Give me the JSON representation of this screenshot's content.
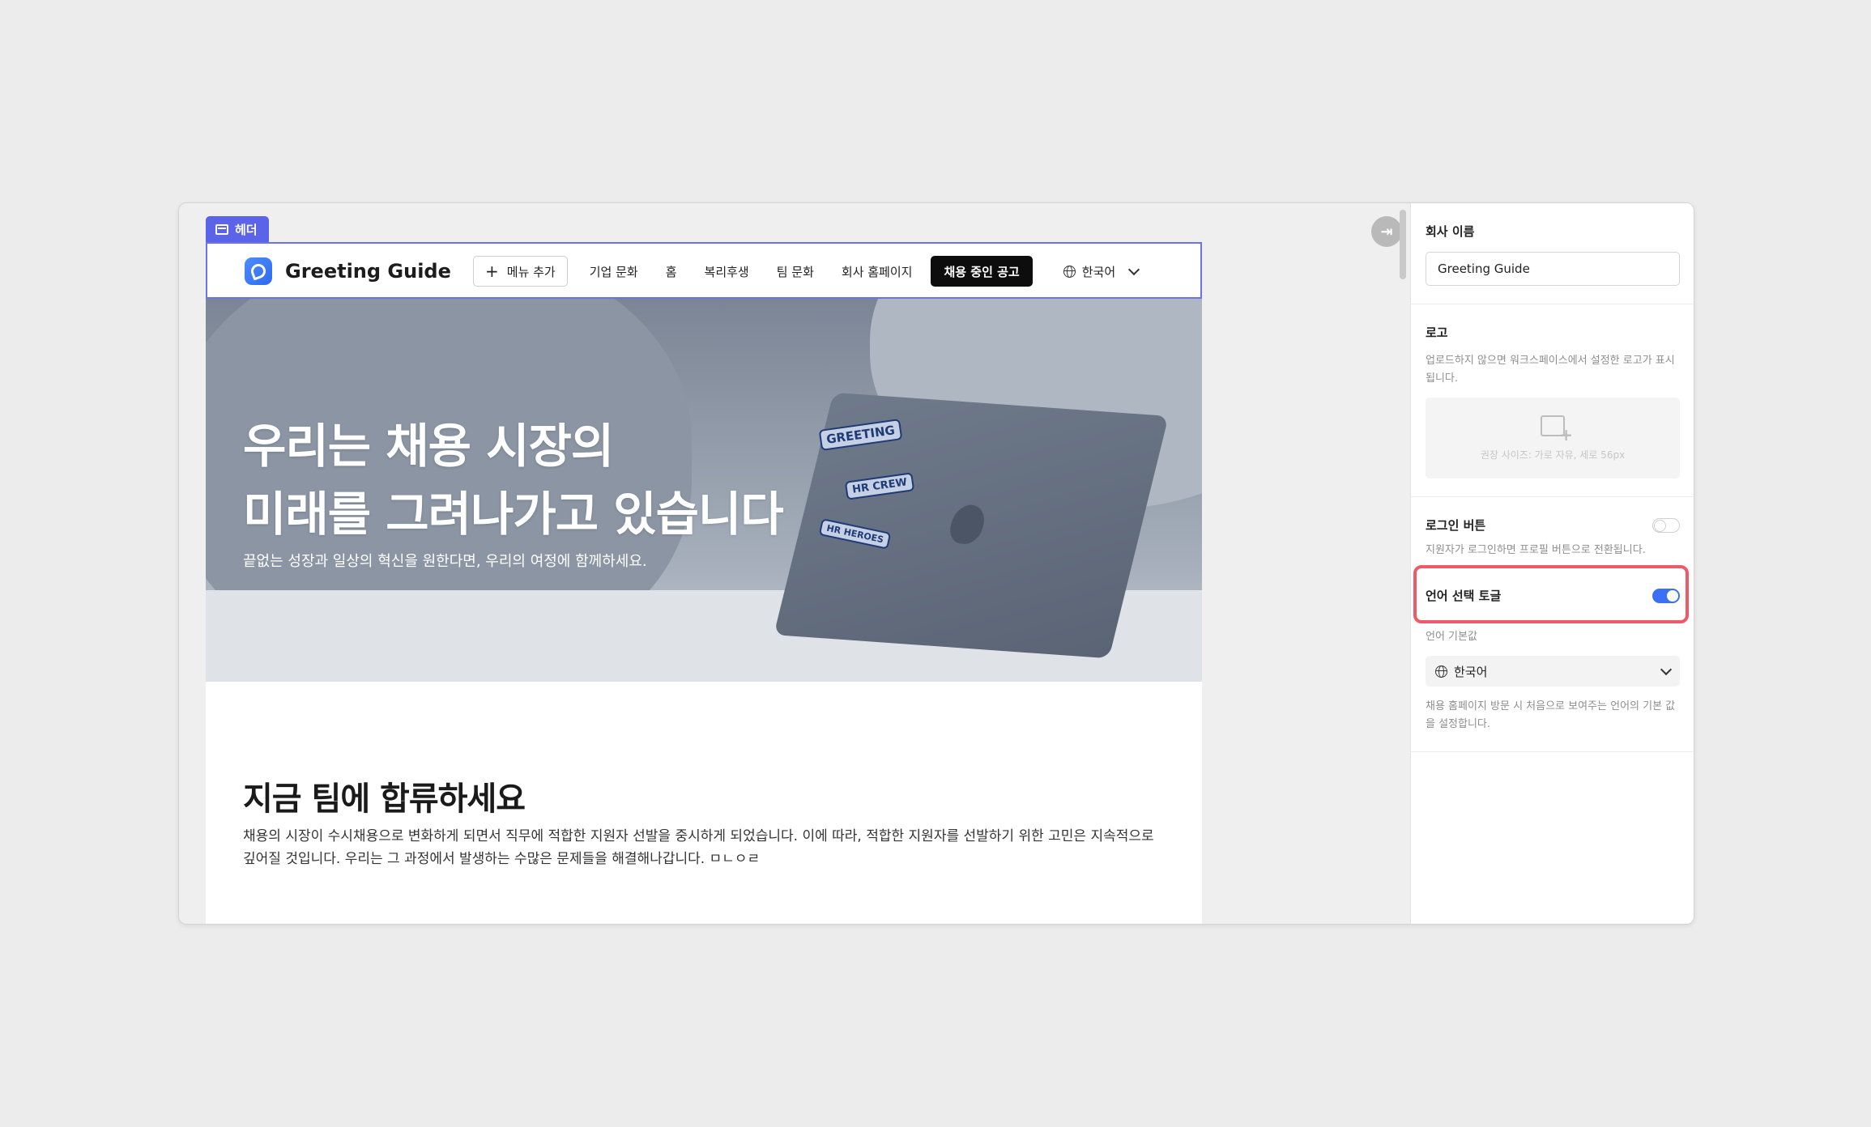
{
  "canvas": {
    "section_tag": "헤더",
    "header": {
      "brand": "Greeting Guide",
      "add_menu": "메뉴 추가",
      "nav_items": [
        "기업 문화",
        "홈",
        "복리후생",
        "팀 문화",
        "회사 홈페이지"
      ],
      "cta": "채용 중인 공고",
      "language": "한국어"
    },
    "hero": {
      "title_line1": "우리는 채용 시장의",
      "title_line2": "미래를 그려나가고 있습니다",
      "subtitle": "끝없는 성장과 일상의 혁신을 원한다면, 우리의 여정에 함께하세요.",
      "sticker1": "GREETING",
      "sticker2": "HR CREW",
      "sticker3": "HR HEROES"
    },
    "join": {
      "title": "지금 팀에 합류하세요",
      "body": "채용의 시장이 수시채용으로 변화하게 되면서 직무에 적합한 지원자 선발을 중시하게 되었습니다. 이에 따라, 적합한 지원자를 선발하기 위한 고민은 지속적으로 깊어질 것입니다. 우리는 그 과정에서 발생하는 수많은 문제들을 해결해나갑니다. ㅁㄴㅇㄹ"
    }
  },
  "panel": {
    "company_name_label": "회사 이름",
    "company_name_value": "Greeting Guide",
    "logo_label": "로고",
    "logo_help": "업로드하지 않으면 워크스페이스에서 설정한 로고가 표시됩니다.",
    "logo_upload_hint": "권장 사이즈: 가로 자유, 세로 56px",
    "login_button_label": "로그인 버튼",
    "login_button_on": false,
    "login_button_help": "지원자가 로그인하면 프로필 버튼으로 전환됩니다.",
    "language_toggle_label": "언어 선택 토글",
    "language_toggle_on": true,
    "language_default_label": "언어 기본값",
    "language_default_value": "한국어",
    "language_default_help": "채용 홈페이지 방문 시 처음으로 보여주는 언어의 기본 값을 설정합니다."
  },
  "colors": {
    "accent": "#5b63e8",
    "toggle_on": "#3b6ff5",
    "highlight": "#ee5a68",
    "cta_bg": "#0d0d0d"
  },
  "icons": [
    "header-section-icon",
    "brand-logo-icon",
    "plus-icon",
    "globe-icon",
    "chevron-down-icon",
    "collapse-panel-icon",
    "image-upload-icon"
  ]
}
